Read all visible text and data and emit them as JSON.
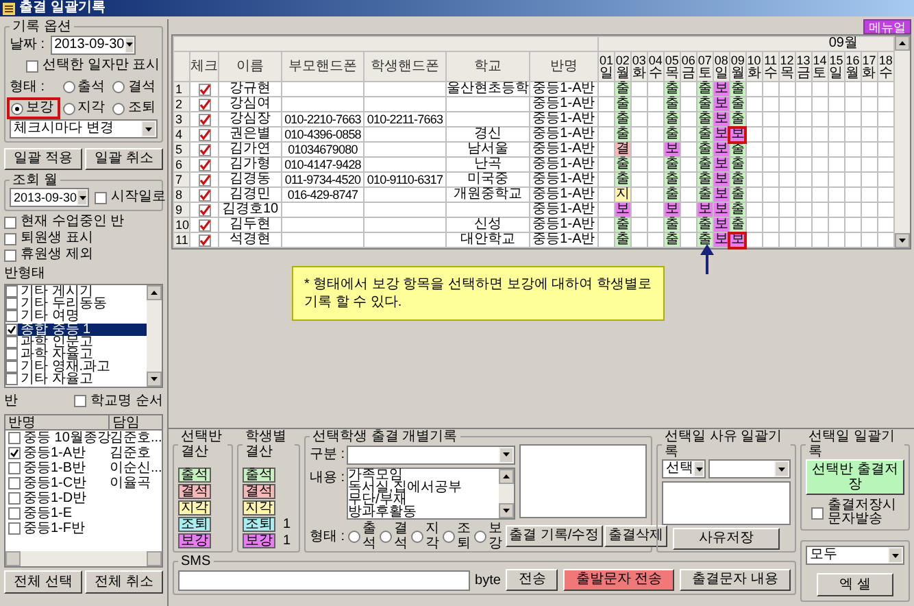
{
  "window": {
    "title": "출결 일괄기록"
  },
  "record_options": {
    "title": "기록 옵션",
    "date_label": "날짜 :",
    "date": "2013-09-30",
    "only_selected": {
      "label": "선택한 일자만 표시",
      "checked": false
    },
    "type_label": "형태 :",
    "types": [
      {
        "label": "출석",
        "selected": false
      },
      {
        "label": "결석",
        "selected": false
      },
      {
        "label": "보강",
        "selected": true
      },
      {
        "label": "지각",
        "selected": false
      },
      {
        "label": "조퇴",
        "selected": false
      }
    ],
    "mode": "체크시마다 변경"
  },
  "apply_buttons": [
    "일괄 적용",
    "일괄 취소"
  ],
  "month_query": {
    "title": "조회 월",
    "date": "2013-09-30",
    "start_day": {
      "label": "시작일로",
      "checked": false
    }
  },
  "filters": [
    {
      "label": "현재 수업중인 반",
      "checked": false
    },
    {
      "label": "퇴원생 표시",
      "checked": false
    },
    {
      "label": "휴원생 제외",
      "checked": false
    }
  ],
  "class_types": {
    "title": "반형태",
    "items": [
      {
        "label": "기타 게시기",
        "checked": false,
        "selected": false
      },
      {
        "label": "기타 두리동동",
        "checked": false,
        "selected": false
      },
      {
        "label": "기타 여명",
        "checked": false,
        "selected": false
      },
      {
        "label": "종합 중등 1",
        "checked": true,
        "selected": true
      },
      {
        "label": "과학 인문고",
        "checked": false,
        "selected": false
      },
      {
        "label": "과학 자율고",
        "checked": false,
        "selected": false
      },
      {
        "label": "기타 영재.과고",
        "checked": false,
        "selected": false
      },
      {
        "label": "기타 자율고",
        "checked": false,
        "selected": false
      }
    ]
  },
  "classes": {
    "title": "반",
    "sort": {
      "label": "학교명 순서",
      "checked": false
    },
    "columns": [
      "반명",
      "담임"
    ],
    "rows": [
      {
        "name": "중등 10월종강",
        "teacher": "김준호...",
        "checked": false
      },
      {
        "name": "중등1-A반",
        "teacher": "김준호",
        "checked": true
      },
      {
        "name": "중등1-B반",
        "teacher": "이순신...",
        "checked": false
      },
      {
        "name": "중등1-C반",
        "teacher": "이율곡",
        "checked": false
      },
      {
        "name": "중등1-D반",
        "checked": false
      },
      {
        "name": "중등1-E",
        "checked": false
      },
      {
        "name": "중등1-F반",
        "checked": false
      }
    ]
  },
  "class_buttons": [
    "전체 선택",
    "전체 취소"
  ],
  "manual_button": "메뉴얼",
  "grid": {
    "month": "09월",
    "columns": [
      "체크",
      "이름",
      "부모핸드폰",
      "학생핸드폰",
      "학교",
      "반명"
    ],
    "days": [
      {
        "date": "01",
        "weekday": "일"
      },
      {
        "date": "02",
        "weekday": "월"
      },
      {
        "date": "03",
        "weekday": "화"
      },
      {
        "date": "04",
        "weekday": "수"
      },
      {
        "date": "05",
        "weekday": "목"
      },
      {
        "date": "06",
        "weekday": "금"
      },
      {
        "date": "07",
        "weekday": "토"
      },
      {
        "date": "08",
        "weekday": "일"
      },
      {
        "date": "09",
        "weekday": "월"
      },
      {
        "date": "10",
        "weekday": "화"
      },
      {
        "date": "11",
        "weekday": "수"
      },
      {
        "date": "12",
        "weekday": "목"
      },
      {
        "date": "13",
        "weekday": "금"
      },
      {
        "date": "14",
        "weekday": "토"
      },
      {
        "date": "15",
        "weekday": "일"
      },
      {
        "date": "16",
        "weekday": "월"
      },
      {
        "date": "17",
        "weekday": "화"
      },
      {
        "date": "18",
        "weekday": "수"
      }
    ],
    "rows": [
      {
        "no": "1",
        "checked": true,
        "name": "강규현",
        "school": "울산현초등학",
        "class": "중등1-A반",
        "attendance": [
          {
            "kind": "blank"
          },
          {
            "kind": "present",
            "mark": "출",
            "highlighted": false
          },
          {
            "kind": "blank"
          },
          {
            "kind": "blank"
          },
          {
            "kind": "present",
            "mark": "출",
            "highlighted": false
          },
          {
            "kind": "blank"
          },
          {
            "kind": "present",
            "mark": "출",
            "highlighted": false
          },
          {
            "kind": "makeup",
            "mark": "보",
            "highlighted": false
          },
          {
            "kind": "present",
            "mark": "출",
            "highlighted": false
          }
        ]
      },
      {
        "no": "2",
        "checked": true,
        "name": "강심여",
        "class": "중등1-A반",
        "attendance": [
          {
            "kind": "blank"
          },
          {
            "kind": "present",
            "mark": "출",
            "highlighted": false
          },
          {
            "kind": "blank"
          },
          {
            "kind": "blank"
          },
          {
            "kind": "present",
            "mark": "출",
            "highlighted": false
          },
          {
            "kind": "blank"
          },
          {
            "kind": "present",
            "mark": "출",
            "highlighted": false
          },
          {
            "kind": "makeup",
            "mark": "보",
            "highlighted": false
          },
          {
            "kind": "present",
            "mark": "출",
            "highlighted": false
          }
        ]
      },
      {
        "no": "3",
        "checked": true,
        "name": "강심장",
        "parent_phone": "010-2210-7663",
        "student_phone": "010-2211-7663",
        "class": "중등1-A반",
        "attendance": [
          {
            "kind": "blank"
          },
          {
            "kind": "present",
            "mark": "출",
            "highlighted": false
          },
          {
            "kind": "blank"
          },
          {
            "kind": "blank"
          },
          {
            "kind": "present",
            "mark": "출",
            "highlighted": false
          },
          {
            "kind": "blank"
          },
          {
            "kind": "present",
            "mark": "출",
            "highlighted": false
          },
          {
            "kind": "makeup",
            "mark": "보",
            "highlighted": false
          },
          {
            "kind": "present",
            "mark": "출",
            "highlighted": false
          }
        ]
      },
      {
        "no": "4",
        "checked": true,
        "name": "권은별",
        "parent_phone": "010-4396-0858",
        "school": "경신",
        "class": "중등1-A반",
        "attendance": [
          {
            "kind": "blank"
          },
          {
            "kind": "present",
            "mark": "출",
            "highlighted": false
          },
          {
            "kind": "blank"
          },
          {
            "kind": "blank"
          },
          {
            "kind": "present",
            "mark": "출",
            "highlighted": false
          },
          {
            "kind": "blank"
          },
          {
            "kind": "present",
            "mark": "출",
            "highlighted": false
          },
          {
            "kind": "makeup",
            "mark": "보",
            "highlighted": false
          },
          {
            "kind": "makeup",
            "mark": "보",
            "highlighted": true
          }
        ]
      },
      {
        "no": "5",
        "checked": true,
        "name": "김가연",
        "parent_phone": "01034679080",
        "school": "남서울",
        "class": "중등1-A반",
        "attendance": [
          {
            "kind": "blank"
          },
          {
            "kind": "absent",
            "mark": "결",
            "highlighted": false
          },
          {
            "kind": "blank"
          },
          {
            "kind": "blank"
          },
          {
            "kind": "makeup",
            "mark": "보",
            "highlighted": false
          },
          {
            "kind": "blank"
          },
          {
            "kind": "present",
            "mark": "출",
            "highlighted": false
          },
          {
            "kind": "makeup",
            "mark": "보",
            "highlighted": false
          },
          {
            "kind": "present",
            "mark": "출",
            "highlighted": false
          }
        ]
      },
      {
        "no": "6",
        "checked": true,
        "name": "김가형",
        "parent_phone": "010-4147-9428",
        "school": "난곡",
        "class": "중등1-A반",
        "attendance": [
          {
            "kind": "blank"
          },
          {
            "kind": "present",
            "mark": "출",
            "highlighted": false
          },
          {
            "kind": "blank"
          },
          {
            "kind": "blank"
          },
          {
            "kind": "present",
            "mark": "출",
            "highlighted": false
          },
          {
            "kind": "blank"
          },
          {
            "kind": "present",
            "mark": "출",
            "highlighted": false
          },
          {
            "kind": "makeup",
            "mark": "보",
            "highlighted": false
          },
          {
            "kind": "present",
            "mark": "출",
            "highlighted": false
          }
        ]
      },
      {
        "no": "7",
        "checked": true,
        "name": "김경동",
        "parent_phone": "011-9734-4520",
        "student_phone": "010-9110-6317",
        "school": "미국중",
        "class": "중등1-A반",
        "attendance": [
          {
            "kind": "blank"
          },
          {
            "kind": "present",
            "mark": "출",
            "highlighted": false
          },
          {
            "kind": "blank"
          },
          {
            "kind": "blank"
          },
          {
            "kind": "present",
            "mark": "출",
            "highlighted": false
          },
          {
            "kind": "blank"
          },
          {
            "kind": "present",
            "mark": "출",
            "highlighted": false
          },
          {
            "kind": "makeup",
            "mark": "보",
            "highlighted": false
          },
          {
            "kind": "present",
            "mark": "출",
            "highlighted": false
          }
        ]
      },
      {
        "no": "8",
        "checked": true,
        "name": "김경민",
        "parent_phone": "016-429-8747",
        "school": "개원중학교",
        "class": "중등1-A반",
        "attendance": [
          {
            "kind": "blank"
          },
          {
            "kind": "late",
            "mark": "지",
            "highlighted": false
          },
          {
            "kind": "blank"
          },
          {
            "kind": "blank"
          },
          {
            "kind": "present",
            "mark": "출",
            "highlighted": false
          },
          {
            "kind": "blank"
          },
          {
            "kind": "present",
            "mark": "출",
            "highlighted": false
          },
          {
            "kind": "makeup",
            "mark": "보",
            "highlighted": false
          },
          {
            "kind": "present",
            "mark": "출",
            "highlighted": false
          }
        ]
      },
      {
        "no": "9",
        "checked": true,
        "name": "김경호10",
        "class": "중등1-A반",
        "attendance": [
          {
            "kind": "blank"
          },
          {
            "kind": "makeup",
            "mark": "보",
            "highlighted": false
          },
          {
            "kind": "blank"
          },
          {
            "kind": "blank"
          },
          {
            "kind": "makeup",
            "mark": "보",
            "highlighted": false
          },
          {
            "kind": "blank"
          },
          {
            "kind": "makeup",
            "mark": "보",
            "highlighted": false
          },
          {
            "kind": "makeup",
            "mark": "보",
            "highlighted": false
          },
          {
            "kind": "present",
            "mark": "출",
            "highlighted": false
          }
        ]
      },
      {
        "no": "10",
        "checked": true,
        "name": "김두현",
        "school": "신성",
        "class": "중등1-A반",
        "attendance": [
          {
            "kind": "blank"
          },
          {
            "kind": "present",
            "mark": "출",
            "highlighted": false
          },
          {
            "kind": "blank"
          },
          {
            "kind": "blank"
          },
          {
            "kind": "present",
            "mark": "출",
            "highlighted": false
          },
          {
            "kind": "blank"
          },
          {
            "kind": "present",
            "mark": "출",
            "highlighted": false
          },
          {
            "kind": "makeup",
            "mark": "보",
            "highlighted": false
          },
          {
            "kind": "present",
            "mark": "출",
            "highlighted": false
          }
        ]
      },
      {
        "no": "11",
        "checked": true,
        "name": "석경현",
        "school": "대안학교",
        "class": "중등1-A반",
        "attendance": [
          {
            "kind": "blank"
          },
          {
            "kind": "present",
            "mark": "출",
            "highlighted": false
          },
          {
            "kind": "blank"
          },
          {
            "kind": "blank"
          },
          {
            "kind": "present",
            "mark": "출",
            "highlighted": false
          },
          {
            "kind": "blank"
          },
          {
            "kind": "present",
            "mark": "출",
            "highlighted": false
          },
          {
            "kind": "makeup",
            "mark": "보",
            "highlighted": false
          },
          {
            "kind": "makeup",
            "mark": "보",
            "highlighted": true
          }
        ]
      }
    ]
  },
  "note": "* 형태에서 보강 항목을 선택하면 보강에 대하여 학생별로 기록 할 수 있다.",
  "class_summary": {
    "title": "선택반 결산",
    "items": [
      {
        "label": "출석",
        "kind": "present"
      },
      {
        "label": "결석",
        "kind": "absent"
      },
      {
        "label": "지각",
        "kind": "late"
      },
      {
        "label": "조퇴",
        "kind": "early"
      },
      {
        "label": "보강",
        "kind": "makeup"
      }
    ]
  },
  "student_summary": {
    "title": "학생별 결산",
    "items": [
      {
        "label": "출석",
        "kind": "present"
      },
      {
        "label": "결석",
        "kind": "absent"
      },
      {
        "label": "지각",
        "kind": "late"
      },
      {
        "label": "조퇴",
        "kind": "early",
        "count": "1"
      },
      {
        "label": "보강",
        "kind": "makeup",
        "count": "1"
      }
    ]
  },
  "individual_record": {
    "title": "선택학생 출결 개별기록",
    "category_label": "구분 :",
    "content_label": "내용 :",
    "reasons": [
      "가족모임",
      "독서실,집에서공부",
      "무단/부재",
      "방과후활동"
    ],
    "type_label": "형태 :",
    "types": [
      {
        "label": "출석",
        "selected": false
      },
      {
        "label": "결석",
        "selected": false
      },
      {
        "label": "지각",
        "selected": false
      },
      {
        "label": "조퇴",
        "selected": false
      },
      {
        "label": "보강",
        "selected": false
      }
    ],
    "buttons": [
      "출결 기록/수정",
      "출결삭제"
    ]
  },
  "day_reason": {
    "title": "선택일 사유 일괄기록",
    "select": "선택",
    "button": "사유저장"
  },
  "day_batch": {
    "title": "선택일 일괄기록",
    "save_button": "선택반 출결저장",
    "sms_on_save": {
      "label": "출결저장시 문자발송",
      "checked": false
    }
  },
  "export": {
    "filter": "모두",
    "button": "엑 셀"
  },
  "sms": {
    "title": "SMS",
    "unit": "byte",
    "buttons": [
      {
        "label": "전송",
        "kind": "normal"
      },
      {
        "label": "출발문자 전송",
        "kind": "alert"
      },
      {
        "label": "출결문자 내용",
        "kind": "normal"
      }
    ]
  }
}
